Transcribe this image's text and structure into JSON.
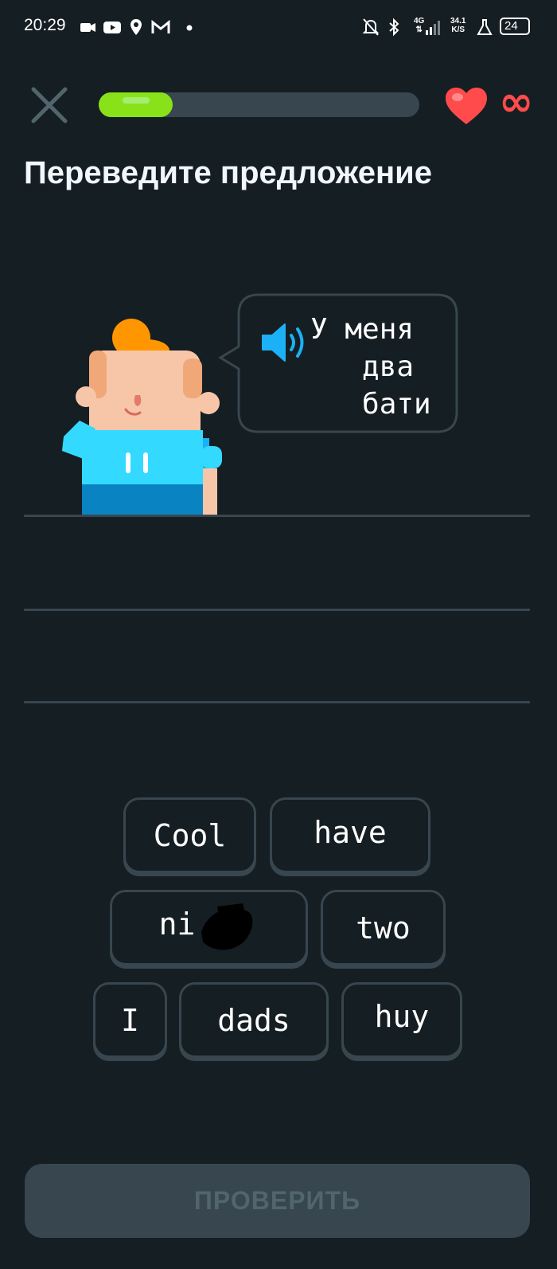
{
  "status_bar": {
    "time": "20:29",
    "network_label": "4G",
    "net_speed_value": "34.1",
    "net_speed_unit": "K/S",
    "battery_level": "24",
    "icons": [
      "video-camera-icon",
      "youtube-icon",
      "location-pin-icon",
      "gmail-icon",
      "dot-icon",
      "mute-bell-icon",
      "bluetooth-icon",
      "signal-icon",
      "flask-icon",
      "battery-icon"
    ]
  },
  "header": {
    "progress_fraction": 0.23,
    "accent_color": "#89e219",
    "heart_color": "#ff4b4b",
    "lives_symbol": "∞"
  },
  "title": "Переведите предложение",
  "prompt": {
    "sentence": "У меня\n   два\n   бати"
  },
  "word_bank": [
    {
      "label": "Cool"
    },
    {
      "label": "have"
    },
    {
      "label": "ni"
    },
    {
      "label": "two"
    },
    {
      "label": "I"
    },
    {
      "label": "dads"
    },
    {
      "label": "huy"
    }
  ],
  "check_button": {
    "label": "ПРОВЕРИТЬ"
  }
}
